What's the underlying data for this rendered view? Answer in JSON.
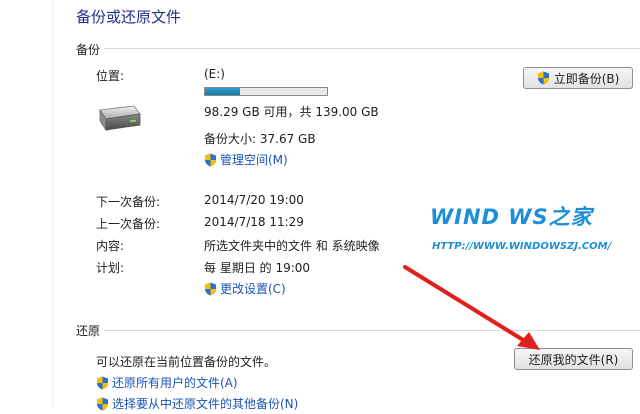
{
  "page": {
    "title": "备份或还原文件"
  },
  "backup": {
    "section_label": "备份",
    "location_label": "位置:",
    "drive": "(E:)",
    "drive_usage_fraction": 0.29,
    "free_text": "98.29 GB 可用，共 139.00 GB",
    "backup_size": "备份大小: 37.67 GB",
    "manage_space": "管理空间(M)",
    "backup_now": "立即备份(B)",
    "next_label": "下一次备份:",
    "next_value": "2014/7/20 19:00",
    "last_label": "上一次备份:",
    "last_value": "2014/7/18 11:29",
    "content_label": "内容:",
    "content_value": "所选文件夹中的文件 和 系统映像",
    "schedule_label": "计划:",
    "schedule_value": "每 星期日 的 19:00",
    "change_settings": "更改设置(C)"
  },
  "restore": {
    "section_label": "还原",
    "description": "可以还原在当前位置备份的文件。",
    "restore_my_files": "还原我的文件(R)",
    "restore_all_users": "还原所有用户的文件(A)",
    "choose_other": "选择要从中还原文件的其他备份(N)"
  },
  "watermark": {
    "logo_text": "WIND WS之家",
    "url": "HTTP://WWW.WINDOWSZJ.COM/"
  },
  "colors": {
    "accent": "#1d8fd6",
    "link": "#1a53b6",
    "arrow": "#e0201c",
    "title": "#1e3287"
  }
}
